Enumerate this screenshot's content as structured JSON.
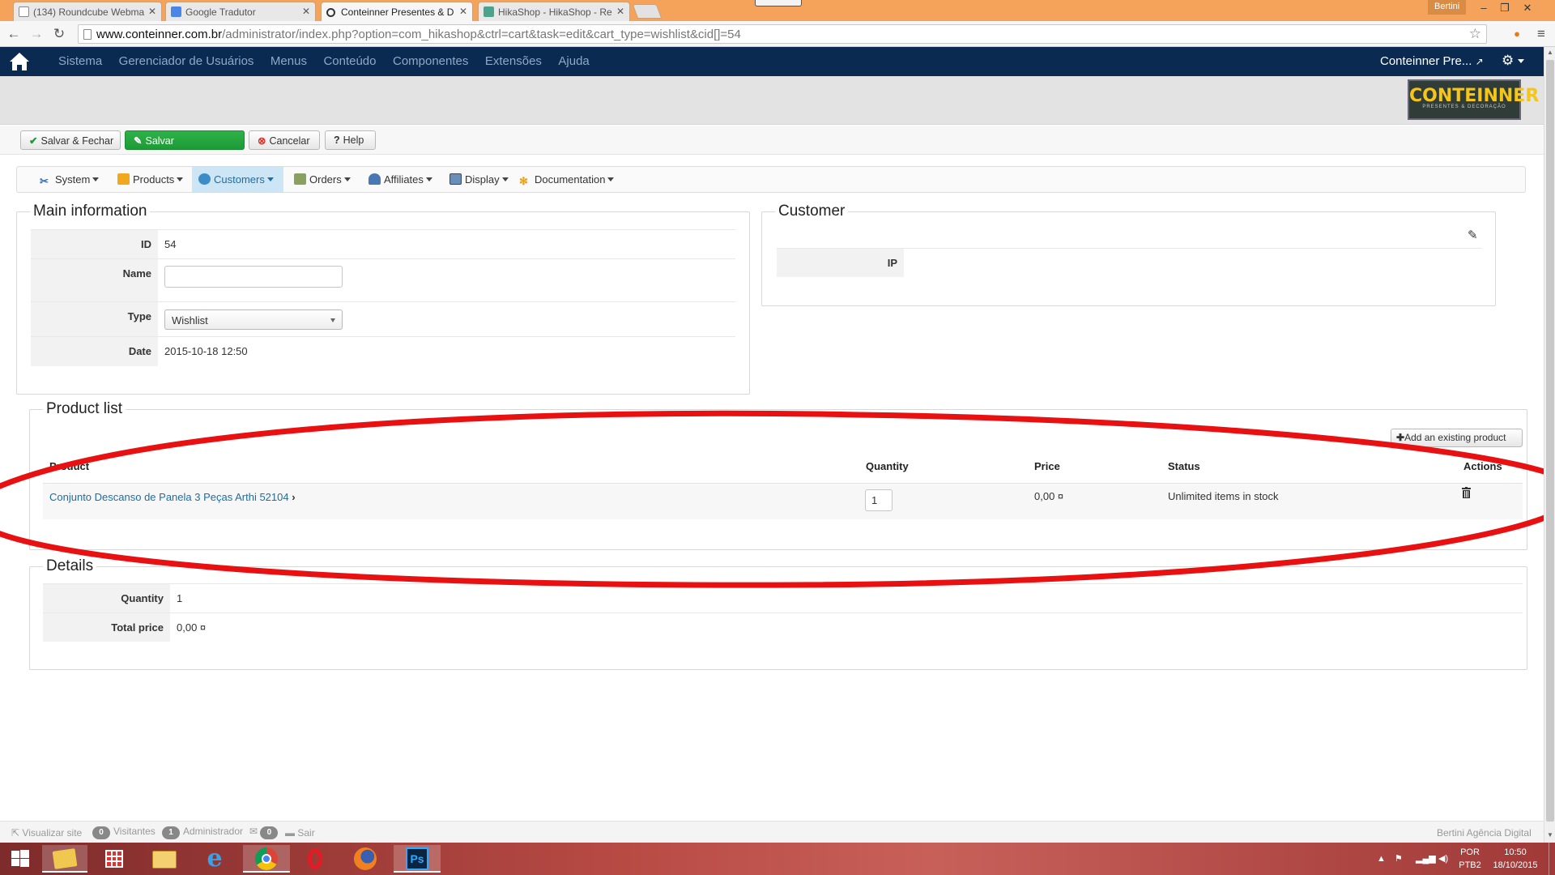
{
  "browser": {
    "tabs": [
      {
        "label": "(134) Roundcube Webma",
        "active": false
      },
      {
        "label": "Google Tradutor",
        "active": false
      },
      {
        "label": "Conteinner Presentes & D",
        "active": true
      },
      {
        "label": "HikaShop - HikaShop - Re",
        "active": false
      }
    ],
    "profile": "Bertini",
    "url_host": "www.conteinner.com.br",
    "url_rest": "/administrator/index.php?option=com_hikashop&ctrl=cart&task=edit&cart_type=wishlist&cid[]=54"
  },
  "topnav": {
    "items": [
      "Sistema",
      "Gerenciador de Usuários",
      "Menus",
      "Conteúdo",
      "Componentes",
      "Extensões",
      "Ajuda"
    ],
    "site_name": "Conteinner Pre..."
  },
  "logo": {
    "text": "CONTEINNER",
    "sub": "PRESENTES & DECORAÇÃO"
  },
  "toolbar": {
    "save_close": "Salvar & Fechar",
    "save": "Salvar",
    "cancel": "Cancelar",
    "help": "Help"
  },
  "hikamenu": {
    "items": [
      "System",
      "Products",
      "Customers",
      "Orders",
      "Affiliates",
      "Display",
      "Documentation"
    ]
  },
  "main_info": {
    "legend": "Main information",
    "id_label": "ID",
    "id_value": "54",
    "name_label": "Name",
    "name_value": "",
    "type_label": "Type",
    "type_value": "Wishlist",
    "date_label": "Date",
    "date_value": "2015-10-18 12:50"
  },
  "customer": {
    "legend": "Customer",
    "ip_label": "IP",
    "ip_value": ""
  },
  "product_list": {
    "legend": "Product list",
    "add_button": "Add an existing product",
    "columns": [
      "Product",
      "Quantity",
      "Price",
      "Status",
      "Actions"
    ],
    "rows": [
      {
        "product": "Conjunto Descanso de Panela 3 Peças Arthi 52104",
        "quantity": "1",
        "price": "0,00 ¤",
        "status": "Unlimited items in stock"
      }
    ]
  },
  "details": {
    "legend": "Details",
    "quantity_label": "Quantity",
    "quantity_value": "1",
    "total_label": "Total price",
    "total_value": "0,00 ¤"
  },
  "statusbar": {
    "view_site": "Visualizar site",
    "visitors_count": "0",
    "visitors": "Visitantes",
    "admin_count": "1",
    "admin": "Administrador",
    "msg_count": "0",
    "logout": "Sair",
    "credit": "Bertini Agência Digital"
  },
  "taskbar": {
    "lang": "POR",
    "layout": "PTB2",
    "time": "10:50",
    "date": "18/10/2015"
  },
  "colors": {
    "nav_bg": "#0b2a52",
    "accent_green": "#1d9a36",
    "link_blue": "#1c6ea4",
    "annotation_red": "#e81010"
  }
}
